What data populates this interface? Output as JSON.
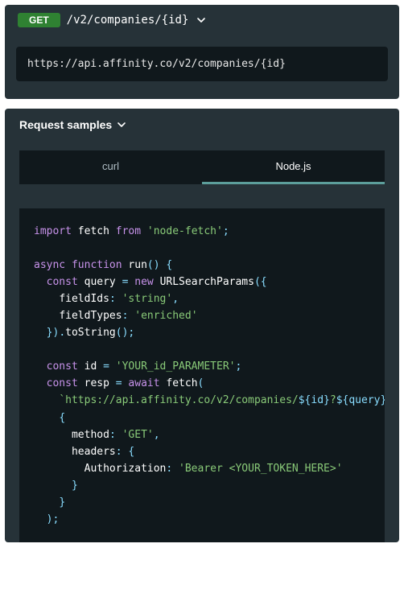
{
  "endpoint": {
    "method": "GET",
    "path": "/v2/companies/{id}",
    "full_url": "https://api.affinity.co/v2/companies/{id}"
  },
  "samples": {
    "title": "Request samples",
    "tabs": [
      {
        "label": "curl",
        "active": false
      },
      {
        "label": "Node.js",
        "active": true
      }
    ]
  },
  "code": {
    "kw_import": "import",
    "ident_fetch": "fetch",
    "kw_from": "from",
    "str_node_fetch": "'node-fetch'",
    "semi": ";",
    "kw_async": "async",
    "kw_function": "function",
    "ident_run": "run",
    "paren_empty": "()",
    "brace_open": "{",
    "kw_const": "const",
    "ident_query": "query",
    "eq": "=",
    "kw_new": "new",
    "ident_urlsp": "URLSearchParams",
    "paren_open": "(",
    "brace_open2": "{",
    "ident_fieldIds": "fieldIds",
    "colon": ":",
    "str_string": "'string'",
    "comma": ",",
    "ident_fieldTypes": "fieldTypes",
    "str_enriched": "'enriched'",
    "brace_close": "}",
    "paren_close": ")",
    "dot": ".",
    "ident_toString": "toString",
    "ident_id": "id",
    "str_id_param": "'YOUR_id_PARAMETER'",
    "ident_resp": "resp",
    "kw_await": "await",
    "ident_fetch2": "fetch",
    "tpl_open": "`",
    "tpl_body": "https://api.affinity.co/v2/companies/",
    "tpl_id": "${id}",
    "tpl_q": "?",
    "tpl_query": "${query}",
    "tpl_close": "`",
    "ident_method": "method",
    "str_get": "'GET'",
    "ident_headers": "headers",
    "ident_auth": "Authorization",
    "str_bearer": "'Bearer <YOUR_TOKEN_HERE>'"
  }
}
